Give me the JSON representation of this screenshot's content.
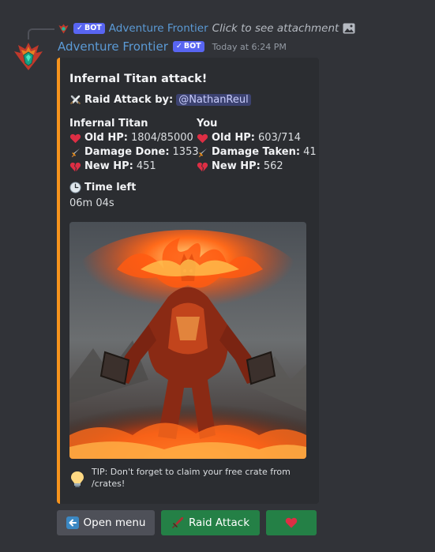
{
  "reply": {
    "bot_tag": "BOT",
    "author": "Adventure Frontier",
    "text": "Click to see attachment"
  },
  "message": {
    "author": "Adventure Frontier",
    "bot_tag": "BOT",
    "timestamp": "Today at 6:24 PM"
  },
  "embed": {
    "accent_color": "#f7941d",
    "title": "Infernal Titan attack!",
    "raid_label": "Raid Attack by:",
    "raid_user": "@NathanReul",
    "boss": {
      "name": "Infernal Titan",
      "old_hp_label": "Old HP:",
      "old_hp": "1804/85000",
      "damage_label": "Damage Done:",
      "damage": "1353",
      "new_hp_label": "New HP:",
      "new_hp": "451"
    },
    "player": {
      "name": "You",
      "old_hp_label": "Old HP:",
      "old_hp": "603/714",
      "damage_label": "Damage Taken:",
      "damage": "41",
      "new_hp_label": "New HP:",
      "new_hp": "562"
    },
    "time_label": "Time left",
    "time_value": "06m 04s",
    "footer_text": "TIP: Don't forget to claim your free crate from /crates!"
  },
  "buttons": [
    {
      "label": "Open menu",
      "icon": "arrow-left-icon",
      "color": "#4e5058"
    },
    {
      "label": "Raid Attack",
      "icon": "sword-icon",
      "color": "#248046"
    },
    {
      "label": "",
      "icon": "heart-icon",
      "color": "#248046"
    }
  ]
}
